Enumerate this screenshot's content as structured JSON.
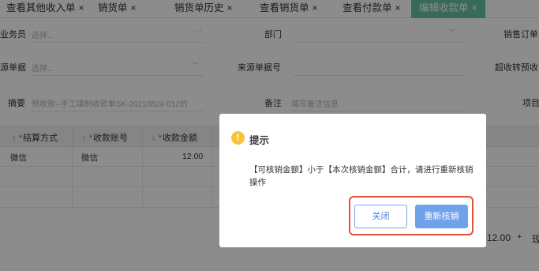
{
  "tabs": [
    {
      "label": "查看其他收入单",
      "closable": true,
      "active": false
    },
    {
      "label": "销货单",
      "closable": true,
      "active": false
    },
    {
      "label": "销货单历史",
      "closable": true,
      "active": false
    },
    {
      "label": "查看销货单",
      "closable": true,
      "active": false
    },
    {
      "label": "查看付款单",
      "closable": true,
      "active": false
    },
    {
      "label": "编辑收款单",
      "closable": true,
      "active": true
    }
  ],
  "close_glyph": "×",
  "form": {
    "salesperson_label": "业务员",
    "salesperson_placeholder": "选择...",
    "department_label": "部门",
    "sales_order_label": "销售订单",
    "source_doc_label": "源单据",
    "source_doc_placeholder": "选择...",
    "source_doc_no_label": "来源单据号",
    "over_receive_label": "超收转预收",
    "summary_label": "摘要",
    "summary_value": "预收款--手工填制收款单SK-20210824-012的",
    "remark_label": "备注",
    "remark_placeholder": "填写备注信息",
    "project_label": "项目"
  },
  "table": {
    "columns": [
      "结算方式",
      "收款账号",
      "收款金额"
    ],
    "rows": [
      {
        "method": "微信",
        "account": "微信",
        "amount": "12.00"
      }
    ],
    "footer_amount": "12.00",
    "footer_plus": "+",
    "footer_right": "现"
  },
  "dialog": {
    "title": "提示",
    "icon": "warning-icon",
    "message": "【可核销金额】小于【本次核销金额】合计，请进行重新核销操作",
    "cancel_label": "关闭",
    "ok_label": "重新核销"
  },
  "colors": {
    "active_tab": "#67c2a0",
    "primary": "#6fa2ea",
    "highlight": "#e2523b",
    "warning": "#f8c33a"
  }
}
